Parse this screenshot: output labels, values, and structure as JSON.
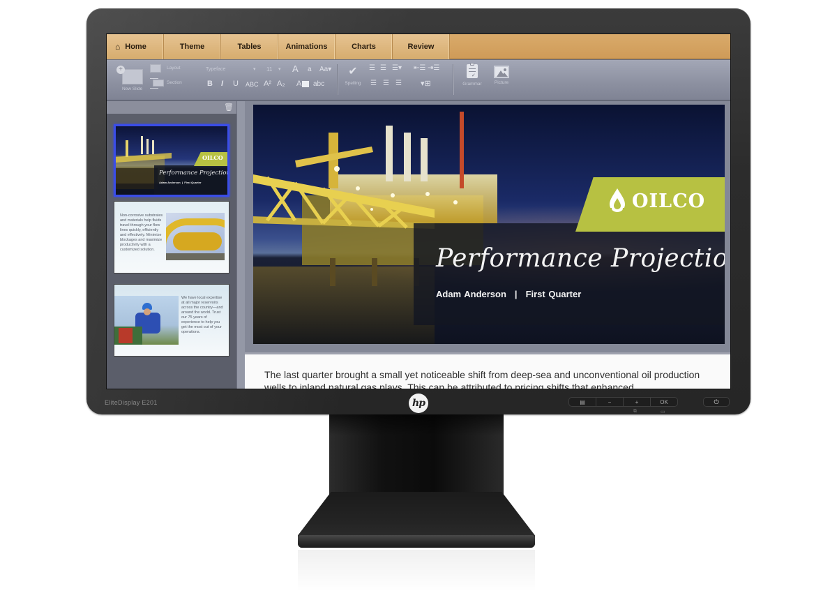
{
  "device": {
    "model_label": "EliteDisplay E201",
    "brand_logo": "hp",
    "osd_buttons": [
      {
        "label": "▤",
        "icon": "menu-icon"
      },
      {
        "label": "−",
        "icon": "minus-icon"
      },
      {
        "label": "+",
        "icon": "plus-icon"
      },
      {
        "label": "OK",
        "icon": "ok-icon"
      }
    ],
    "osd_sub_icons": [
      "input-source-icon",
      "display-mode-icon"
    ],
    "power_glyph": "⏻"
  },
  "ribbon": {
    "tabs": [
      {
        "label": "Home",
        "icon": "home-icon",
        "active": true
      },
      {
        "label": "Theme"
      },
      {
        "label": "Tables"
      },
      {
        "label": "Animations"
      },
      {
        "label": "Charts"
      },
      {
        "label": "Review"
      }
    ]
  },
  "toolbar": {
    "new_slide": "New Slide",
    "layout": "Layout",
    "section": "Section",
    "typeface_placeholder": "Typeface",
    "font_size": "11",
    "grow_font": "A",
    "shrink_font": "a",
    "change_case": "Aa▾",
    "bold": "B",
    "italic": "I",
    "underline": "U",
    "strikethrough": "ABC",
    "superscript": "A²",
    "subscript": "A₂",
    "font_color": "A",
    "highlight": "abc",
    "spelling": "Spelling",
    "grammar": "Grammar",
    "picture": "Picture"
  },
  "sidebar": {
    "trash_icon": "trash-icon",
    "slides": [
      {
        "index": 1,
        "selected": true,
        "brand": "OILCO",
        "title": "Performance Projections",
        "subtitle": "Adam Anderson  |  First Quarter"
      },
      {
        "index": 2,
        "selected": false,
        "text": "Non-corrosive substrates and materials help fluids travel through your flow lines quickly, efficiently and effectively. Minimize blockages and maximize productivity with a customized solution."
      },
      {
        "index": 3,
        "selected": false,
        "text": "We have local expertise at all major reservoirs across the country—and around the world. Trust our 75 years of experience to help you get the most out of your operations."
      }
    ]
  },
  "slide": {
    "brand": "OILCO",
    "title": "Performance Projections",
    "author": "Adam Anderson",
    "separator": "|",
    "period": "First Quarter",
    "colors": {
      "brand_band": "#b7c142",
      "panel": "#121622"
    }
  },
  "notes": {
    "text": "The last quarter brought a small yet noticeable shift from deep-sea and unconventional oil production wells to inland natural gas plays. This can be attributed to pricing shifts that enhanced"
  },
  "colors": {
    "ribbon_tab": "#d9aa6a",
    "toolbar": "#8c90a0",
    "selection": "#3a4de8",
    "bezel": "#2c2c2c"
  }
}
